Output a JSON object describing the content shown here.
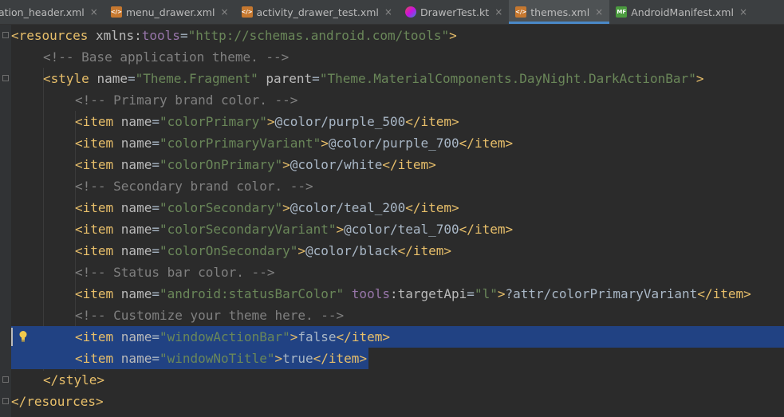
{
  "tabs": [
    {
      "label": "ation_header.xml",
      "icon": "none",
      "active": false
    },
    {
      "label": "menu_drawer.xml",
      "icon": "xml-file-icon",
      "active": false
    },
    {
      "label": "activity_drawer_test.xml",
      "icon": "xml-file-icon",
      "active": false
    },
    {
      "label": "DrawerTest.kt",
      "icon": "kotlin-file-icon",
      "active": false
    },
    {
      "label": "themes.xml",
      "icon": "xml-file-icon",
      "active": true
    },
    {
      "label": "AndroidManifest.xml",
      "icon": "manifest-file-icon",
      "active": false
    }
  ],
  "icon_text": {
    "xml": "</>",
    "manifest": "MF"
  },
  "close_glyph": "×",
  "colors": {
    "tag": "#e8bf6a",
    "attribute": "#bababa",
    "namespace": "#9876aa",
    "value": "#6a8759",
    "comment": "#808080",
    "text": "#a9b7c6",
    "selection": "#214283",
    "background": "#2b2b2b"
  },
  "lines": [
    {
      "indent": 0,
      "tokens": [
        [
          "tag",
          "<resources "
        ],
        [
          "attr",
          "xmlns:"
        ],
        [
          "ns",
          "tools"
        ],
        [
          "txt",
          "="
        ],
        [
          "val",
          "\"http://schemas.android.com/tools\""
        ],
        [
          "tag",
          ">"
        ]
      ]
    },
    {
      "indent": 1,
      "tokens": [
        [
          "cmt",
          "<!-- Base application theme. -->"
        ]
      ]
    },
    {
      "indent": 1,
      "tokens": [
        [
          "tag",
          "<style "
        ],
        [
          "attr",
          "name"
        ],
        [
          "txt",
          "="
        ],
        [
          "val",
          "\"Theme.Fragment\""
        ],
        [
          "txt",
          " "
        ],
        [
          "attr",
          "parent"
        ],
        [
          "txt",
          "="
        ],
        [
          "val",
          "\"Theme.MaterialComponents.DayNight.DarkActionBar\""
        ],
        [
          "tag",
          ">"
        ]
      ]
    },
    {
      "indent": 2,
      "tokens": [
        [
          "cmt",
          "<!-- Primary brand color. -->"
        ]
      ]
    },
    {
      "indent": 2,
      "tokens": [
        [
          "tag",
          "<item "
        ],
        [
          "attr",
          "name"
        ],
        [
          "txt",
          "="
        ],
        [
          "val",
          "\"colorPrimary\""
        ],
        [
          "tag",
          ">"
        ],
        [
          "txt",
          "@color/purple_500"
        ],
        [
          "tag",
          "</item>"
        ]
      ]
    },
    {
      "indent": 2,
      "tokens": [
        [
          "tag",
          "<item "
        ],
        [
          "attr",
          "name"
        ],
        [
          "txt",
          "="
        ],
        [
          "val",
          "\"colorPrimaryVariant\""
        ],
        [
          "tag",
          ">"
        ],
        [
          "txt",
          "@color/purple_700"
        ],
        [
          "tag",
          "</item>"
        ]
      ]
    },
    {
      "indent": 2,
      "tokens": [
        [
          "tag",
          "<item "
        ],
        [
          "attr",
          "name"
        ],
        [
          "txt",
          "="
        ],
        [
          "val",
          "\"colorOnPrimary\""
        ],
        [
          "tag",
          ">"
        ],
        [
          "txt",
          "@color/white"
        ],
        [
          "tag",
          "</item>"
        ]
      ]
    },
    {
      "indent": 2,
      "tokens": [
        [
          "cmt",
          "<!-- Secondary brand color. -->"
        ]
      ]
    },
    {
      "indent": 2,
      "tokens": [
        [
          "tag",
          "<item "
        ],
        [
          "attr",
          "name"
        ],
        [
          "txt",
          "="
        ],
        [
          "val",
          "\"colorSecondary\""
        ],
        [
          "tag",
          ">"
        ],
        [
          "txt",
          "@color/teal_200"
        ],
        [
          "tag",
          "</item>"
        ]
      ]
    },
    {
      "indent": 2,
      "tokens": [
        [
          "tag",
          "<item "
        ],
        [
          "attr",
          "name"
        ],
        [
          "txt",
          "="
        ],
        [
          "val",
          "\"colorSecondaryVariant\""
        ],
        [
          "tag",
          ">"
        ],
        [
          "txt",
          "@color/teal_700"
        ],
        [
          "tag",
          "</item>"
        ]
      ]
    },
    {
      "indent": 2,
      "tokens": [
        [
          "tag",
          "<item "
        ],
        [
          "attr",
          "name"
        ],
        [
          "txt",
          "="
        ],
        [
          "val",
          "\"colorOnSecondary\""
        ],
        [
          "tag",
          ">"
        ],
        [
          "txt",
          "@color/black"
        ],
        [
          "tag",
          "</item>"
        ]
      ]
    },
    {
      "indent": 2,
      "tokens": [
        [
          "cmt",
          "<!-- Status bar color. -->"
        ]
      ]
    },
    {
      "indent": 2,
      "tokens": [
        [
          "tag",
          "<item "
        ],
        [
          "attr",
          "name"
        ],
        [
          "txt",
          "="
        ],
        [
          "val",
          "\"android:statusBarColor\""
        ],
        [
          "txt",
          " "
        ],
        [
          "ns",
          "tools"
        ],
        [
          "attr",
          ":targetApi"
        ],
        [
          "txt",
          "="
        ],
        [
          "val",
          "\"l\""
        ],
        [
          "tag",
          ">"
        ],
        [
          "txt",
          "?attr/colorPrimaryVariant"
        ],
        [
          "tag",
          "</item>"
        ]
      ]
    },
    {
      "indent": 2,
      "tokens": [
        [
          "cmt",
          "<!-- Customize your theme here. -->"
        ]
      ]
    },
    {
      "indent": 2,
      "selected": "full",
      "bulb": true,
      "tokens": [
        [
          "tag",
          "<item "
        ],
        [
          "attr",
          "name"
        ],
        [
          "txt",
          "="
        ],
        [
          "val",
          "\"windowActionBar\""
        ],
        [
          "tag",
          ">"
        ],
        [
          "txt",
          "false"
        ],
        [
          "tag",
          "</item>"
        ]
      ]
    },
    {
      "indent": 2,
      "selected": "partial",
      "tokens": [
        [
          "tag",
          "<item "
        ],
        [
          "attr",
          "name"
        ],
        [
          "txt",
          "="
        ],
        [
          "val",
          "\"windowNoTitle\""
        ],
        [
          "tag",
          ">"
        ],
        [
          "txt",
          "true"
        ],
        [
          "tag",
          "</item>"
        ]
      ]
    },
    {
      "indent": 1,
      "tokens": [
        [
          "tag",
          "</style>"
        ]
      ]
    },
    {
      "indent": 0,
      "tokens": [
        [
          "tag",
          "</resources>"
        ]
      ]
    }
  ]
}
